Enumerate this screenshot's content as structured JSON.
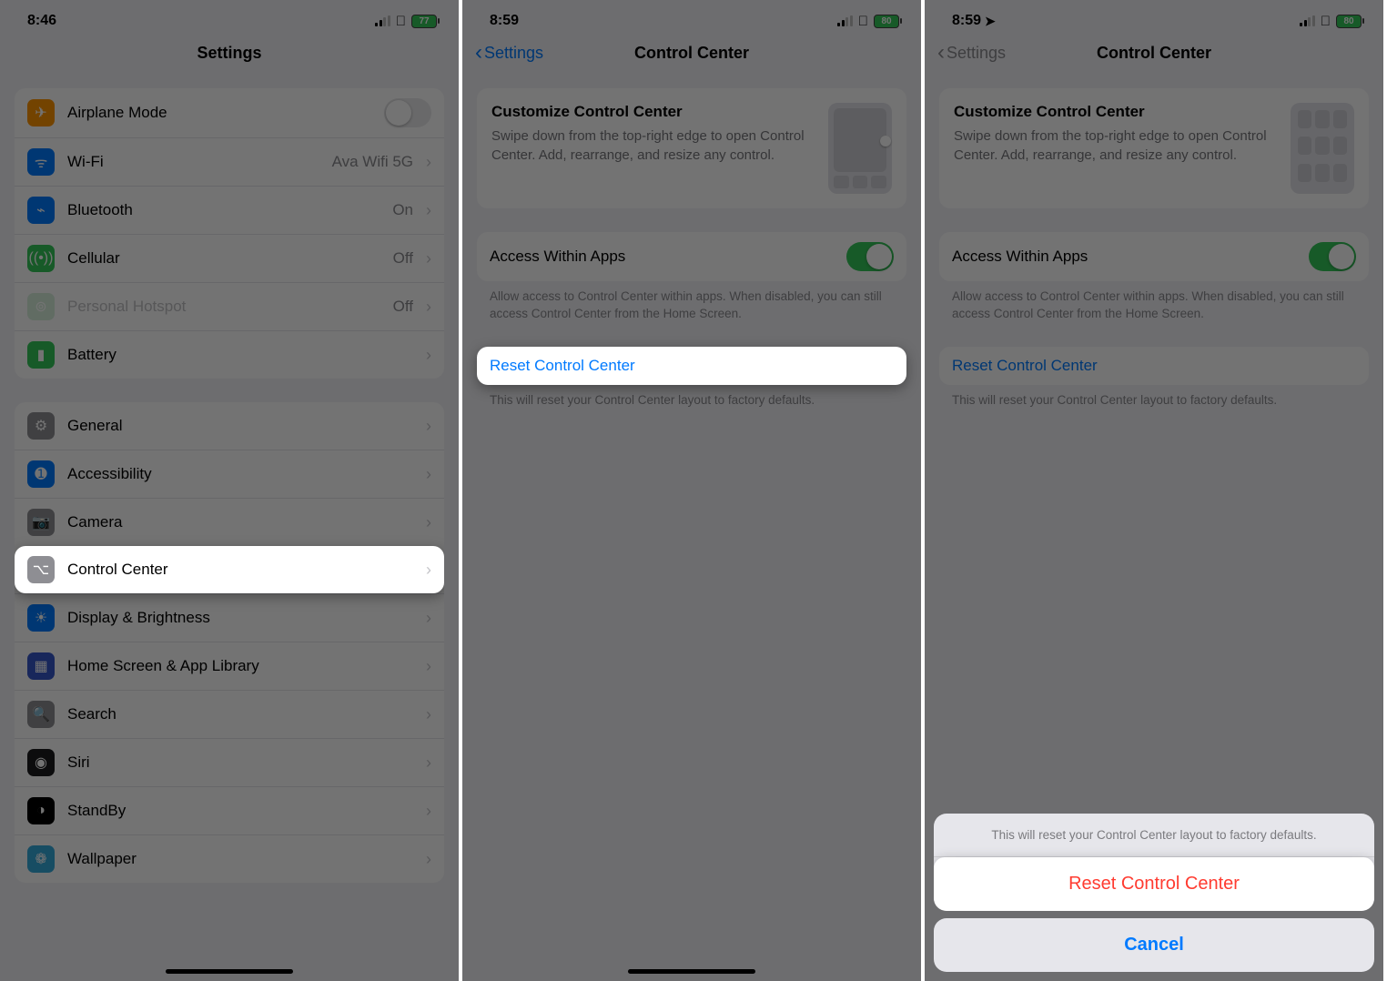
{
  "phone1": {
    "time": "8:46",
    "battery": "77",
    "title": "Settings",
    "group1": [
      {
        "icon": "airplane",
        "bg": "#ff9500",
        "label": "Airplane Mode",
        "toggle": false
      },
      {
        "icon": "wifi",
        "bg": "#007aff",
        "label": "Wi-Fi",
        "value": "Ava Wifi 5G",
        "chev": true
      },
      {
        "icon": "bt",
        "bg": "#007aff",
        "label": "Bluetooth",
        "value": "On",
        "chev": true
      },
      {
        "icon": "cell",
        "bg": "#34c759",
        "label": "Cellular",
        "value": "Off",
        "chev": true
      },
      {
        "icon": "hotspot",
        "bg": "#d7f0dc",
        "label": "Personal Hotspot",
        "value": "Off",
        "chev": true,
        "disabled": true
      },
      {
        "icon": "battery",
        "bg": "#34c759",
        "label": "Battery",
        "chev": true
      }
    ],
    "group2": [
      {
        "icon": "gear",
        "bg": "#8e8e93",
        "label": "General",
        "chev": true
      },
      {
        "icon": "access",
        "bg": "#007aff",
        "label": "Accessibility",
        "chev": true
      },
      {
        "icon": "camera",
        "bg": "#8e8e93",
        "label": "Camera",
        "chev": true
      },
      {
        "icon": "cc",
        "bg": "#8e8e93",
        "label": "Control Center",
        "chev": true,
        "highlight": true
      },
      {
        "icon": "display",
        "bg": "#007aff",
        "label": "Display & Brightness",
        "chev": true
      },
      {
        "icon": "home",
        "bg": "#3557c9",
        "label": "Home Screen & App Library",
        "chev": true
      },
      {
        "icon": "search",
        "bg": "#8e8e93",
        "label": "Search",
        "chev": true
      },
      {
        "icon": "siri",
        "bg": "#1c1c1e",
        "label": "Siri",
        "chev": true
      },
      {
        "icon": "standby",
        "bg": "#000000",
        "label": "StandBy",
        "chev": true
      },
      {
        "icon": "wall",
        "bg": "#34aadc",
        "label": "Wallpaper",
        "chev": true
      }
    ]
  },
  "phone2": {
    "time": "8:59",
    "battery": "80",
    "back": "Settings",
    "title": "Control Center",
    "customize_title": "Customize Control Center",
    "customize_body": "Swipe down from the top-right edge to open Control Center. Add, rearrange, and resize any control.",
    "access_label": "Access Within Apps",
    "access_note": "Allow access to Control Center within apps. When disabled, you can still access Control Center from the Home Screen.",
    "reset_label": "Reset Control Center",
    "reset_note": "This will reset your Control Center layout to factory defaults."
  },
  "phone3": {
    "time": "8:59",
    "battery": "80",
    "back": "Settings",
    "title": "Control Center",
    "customize_title": "Customize Control Center",
    "customize_body": "Swipe down from the top-right edge to open Control Center. Add, rearrange, and resize any control.",
    "access_label": "Access Within Apps",
    "access_note": "Allow access to Control Center within apps. When disabled, you can still access Control Center from the Home Screen.",
    "reset_label": "Reset Control Center",
    "reset_note": "This will reset your Control Center layout to factory defaults.",
    "sheet_msg": "This will reset your Control Center layout to factory defaults.",
    "sheet_action": "Reset Control Center",
    "sheet_cancel": "Cancel"
  },
  "icons": {
    "airplane": "✈",
    "wifi": "ᯤ",
    "bt": "⌁",
    "cell": "((•))",
    "hotspot": "⊚",
    "battery": "▮",
    "gear": "⚙",
    "access": "➊",
    "camera": "📷",
    "cc": "⌥",
    "display": "☀",
    "home": "▦",
    "search": "🔍",
    "siri": "◉",
    "standby": "◑",
    "wall": "❁"
  }
}
